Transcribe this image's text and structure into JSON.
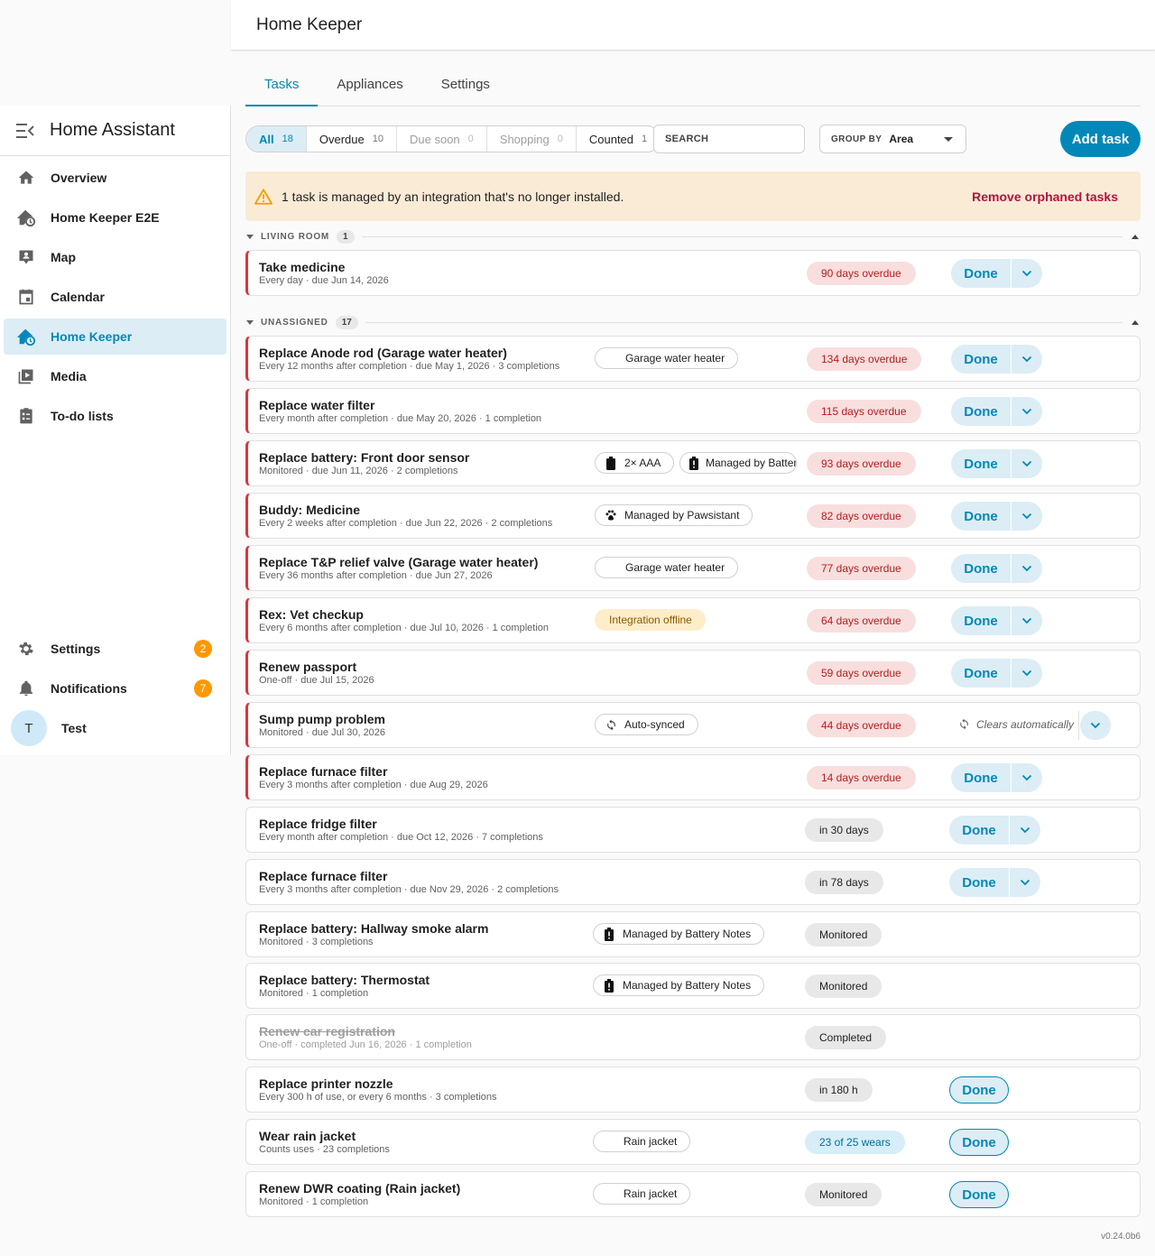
{
  "app": {
    "title": "Home Assistant",
    "page_title": "Home Keeper",
    "version": "v0.24.0b6"
  },
  "colors": {
    "accent": "#0288b8",
    "overdue": "#d9363e",
    "badge": "#ff9800",
    "warning_bg": "#faebd6",
    "remove_link": "#b0133e"
  },
  "sidebar": {
    "items": [
      {
        "label": "Overview",
        "icon": "home-icon"
      },
      {
        "label": "Home Keeper E2E",
        "icon": "home-clock-icon"
      },
      {
        "label": "Map",
        "icon": "map-account-icon"
      },
      {
        "label": "Calendar",
        "icon": "calendar-icon"
      },
      {
        "label": "Home Keeper",
        "icon": "home-clock-icon",
        "active": true
      },
      {
        "label": "Media",
        "icon": "media-icon"
      },
      {
        "label": "To-do lists",
        "icon": "clipboard-list-icon"
      }
    ],
    "bottom": [
      {
        "label": "Settings",
        "icon": "gear-icon",
        "badge": "2"
      },
      {
        "label": "Notifications",
        "icon": "bell-icon",
        "badge": "7"
      }
    ],
    "user": {
      "initial": "T",
      "name": "Test"
    }
  },
  "tabs": [
    {
      "label": "Tasks",
      "active": true
    },
    {
      "label": "Appliances"
    },
    {
      "label": "Settings"
    }
  ],
  "filters": [
    {
      "label": "All",
      "count": "18",
      "active": true
    },
    {
      "label": "Overdue",
      "count": "10"
    },
    {
      "label": "Due soon",
      "count": "0",
      "muted": true
    },
    {
      "label": "Shopping",
      "count": "0",
      "muted": true
    },
    {
      "label": "Counted",
      "count": "1"
    }
  ],
  "search": {
    "placeholder": "SEARCH"
  },
  "group_by": {
    "label": "GROUP BY",
    "value": "Area"
  },
  "add_task_label": "Add task",
  "warning": {
    "text": "1 task is managed by an integration that's no longer installed.",
    "action": "Remove orphaned tasks"
  },
  "groups": [
    {
      "name": "LIVING ROOM",
      "count": "1"
    },
    {
      "name": "UNASSIGNED",
      "count": "17"
    }
  ],
  "done_label": "Done",
  "clears_label": "Clears automatically",
  "tasks": [
    {
      "name": "Take medicine",
      "sub": "Every day · due Jun 14, 2026",
      "status": "90 days overdue",
      "kind": "od",
      "action": "split",
      "overdue": true
    },
    {
      "name": "Replace Anode rod (Garage water heater)",
      "sub": "Every 12 months after completion · due May 1, 2026 · 3 completions",
      "chips": [
        {
          "text": "Garage water heater"
        }
      ],
      "status": "134 days overdue",
      "kind": "od",
      "action": "split",
      "overdue": true
    },
    {
      "name": "Replace water filter",
      "sub": "Every month after completion · due May 20, 2026 · 1 completion",
      "status": "115 days overdue",
      "kind": "od",
      "action": "split",
      "overdue": true
    },
    {
      "name": "Replace battery: Front door sensor",
      "sub": "Monitored · due Jun 11, 2026 · 2 completions",
      "chips": [
        {
          "text": "2× AAA",
          "icon": "battery-icon"
        },
        {
          "text": "Managed by Battery Notes",
          "icon": "battery-alert-icon"
        }
      ],
      "status": "93 days overdue",
      "kind": "od",
      "action": "split",
      "overdue": true
    },
    {
      "name": "Buddy: Medicine",
      "sub": "Every 2 weeks after completion · due Jun 22, 2026 · 2 completions",
      "chips": [
        {
          "text": "Managed by Pawsistant",
          "icon": "paw-icon"
        }
      ],
      "status": "82 days overdue",
      "kind": "od",
      "action": "split",
      "overdue": true
    },
    {
      "name": "Replace T&P relief valve (Garage water heater)",
      "sub": "Every 36 months after completion · due Jun 27, 2026",
      "chips": [
        {
          "text": "Garage water heater"
        }
      ],
      "status": "77 days overdue",
      "kind": "od",
      "action": "split",
      "overdue": true
    },
    {
      "name": "Rex: Vet checkup",
      "sub": "Every 6 months after completion · due Jul 10, 2026 · 1 completion",
      "chips": [
        {
          "text": "Integration offline",
          "offline": true
        }
      ],
      "status": "64 days overdue",
      "kind": "od",
      "action": "split",
      "overdue": true
    },
    {
      "name": "Renew passport",
      "sub": "One-off · due Jul 15, 2026",
      "status": "59 days overdue",
      "kind": "od",
      "action": "split",
      "overdue": true
    },
    {
      "name": "Sump pump problem",
      "sub": "Monitored · due Jul 30, 2026",
      "chips": [
        {
          "text": "Auto-synced",
          "icon": "sync-icon"
        }
      ],
      "status": "44 days overdue",
      "kind": "od",
      "action": "clears",
      "overdue": true
    },
    {
      "name": "Replace furnace filter",
      "sub": "Every 3 months after completion · due Aug 29, 2026",
      "status": "14 days overdue",
      "kind": "od",
      "action": "split",
      "overdue": true
    },
    {
      "name": "Replace fridge filter",
      "sub": "Every month after completion · due Oct 12, 2026 · 7 completions",
      "status": "in 30 days",
      "kind": "neutral",
      "action": "split"
    },
    {
      "name": "Replace furnace filter",
      "sub": "Every 3 months after completion · due Nov 29, 2026 · 2 completions",
      "status": "in 78 days",
      "kind": "neutral",
      "action": "split"
    },
    {
      "name": "Replace battery: Hallway smoke alarm",
      "sub": "Monitored · 3 completions",
      "chips": [
        {
          "text": "Managed by Battery Notes",
          "icon": "battery-alert-icon"
        }
      ],
      "status": "Monitored",
      "kind": "neutral",
      "action": "none"
    },
    {
      "name": "Replace battery: Thermostat",
      "sub": "Monitored · 1 completion",
      "chips": [
        {
          "text": "Managed by Battery Notes",
          "icon": "battery-alert-icon"
        }
      ],
      "status": "Monitored",
      "kind": "neutral",
      "action": "none"
    },
    {
      "name": "Renew car registration",
      "sub": "One-off · completed Jun 16, 2026 · 1 completion",
      "status": "Completed",
      "kind": "neutral",
      "action": "none",
      "completed": true
    },
    {
      "name": "Replace printer nozzle",
      "sub": "Every 300 h of use, or every 6 months · 3 completions",
      "status": "in 180 h",
      "kind": "neutral",
      "action": "outline"
    },
    {
      "name": "Wear rain jacket",
      "sub": "Counts uses · 23 completions",
      "chips": [
        {
          "text": "Rain jacket"
        }
      ],
      "status": "23 of 25 wears",
      "kind": "info",
      "action": "outline"
    },
    {
      "name": "Renew DWR coating (Rain jacket)",
      "sub": "Monitored · 1 completion",
      "chips": [
        {
          "text": "Rain jacket"
        }
      ],
      "status": "Monitored",
      "kind": "neutral",
      "action": "outline"
    }
  ]
}
